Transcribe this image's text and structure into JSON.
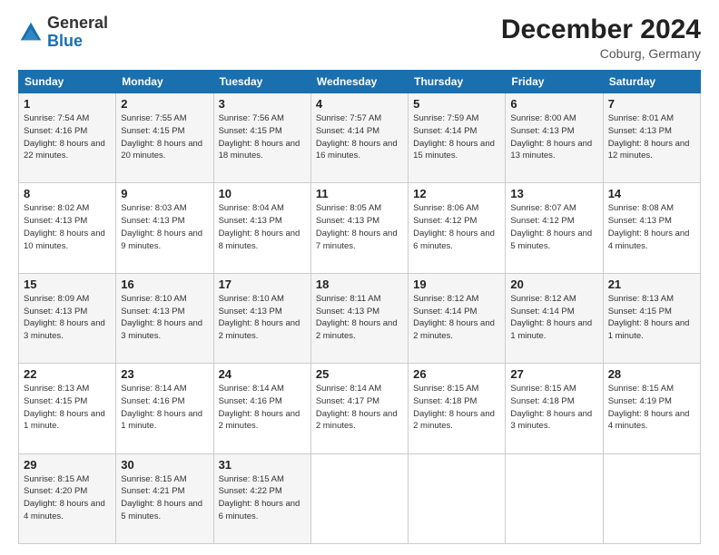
{
  "header": {
    "logo_general": "General",
    "logo_blue": "Blue",
    "month_title": "December 2024",
    "location": "Coburg, Germany"
  },
  "days_of_week": [
    "Sunday",
    "Monday",
    "Tuesday",
    "Wednesday",
    "Thursday",
    "Friday",
    "Saturday"
  ],
  "weeks": [
    [
      {
        "day": 1,
        "sunrise": "7:54 AM",
        "sunset": "4:16 PM",
        "daylight": "8 hours and 22 minutes."
      },
      {
        "day": 2,
        "sunrise": "7:55 AM",
        "sunset": "4:15 PM",
        "daylight": "8 hours and 20 minutes."
      },
      {
        "day": 3,
        "sunrise": "7:56 AM",
        "sunset": "4:15 PM",
        "daylight": "8 hours and 18 minutes."
      },
      {
        "day": 4,
        "sunrise": "7:57 AM",
        "sunset": "4:14 PM",
        "daylight": "8 hours and 16 minutes."
      },
      {
        "day": 5,
        "sunrise": "7:59 AM",
        "sunset": "4:14 PM",
        "daylight": "8 hours and 15 minutes."
      },
      {
        "day": 6,
        "sunrise": "8:00 AM",
        "sunset": "4:13 PM",
        "daylight": "8 hours and 13 minutes."
      },
      {
        "day": 7,
        "sunrise": "8:01 AM",
        "sunset": "4:13 PM",
        "daylight": "8 hours and 12 minutes."
      }
    ],
    [
      {
        "day": 8,
        "sunrise": "8:02 AM",
        "sunset": "4:13 PM",
        "daylight": "8 hours and 10 minutes."
      },
      {
        "day": 9,
        "sunrise": "8:03 AM",
        "sunset": "4:13 PM",
        "daylight": "8 hours and 9 minutes."
      },
      {
        "day": 10,
        "sunrise": "8:04 AM",
        "sunset": "4:13 PM",
        "daylight": "8 hours and 8 minutes."
      },
      {
        "day": 11,
        "sunrise": "8:05 AM",
        "sunset": "4:13 PM",
        "daylight": "8 hours and 7 minutes."
      },
      {
        "day": 12,
        "sunrise": "8:06 AM",
        "sunset": "4:12 PM",
        "daylight": "8 hours and 6 minutes."
      },
      {
        "day": 13,
        "sunrise": "8:07 AM",
        "sunset": "4:12 PM",
        "daylight": "8 hours and 5 minutes."
      },
      {
        "day": 14,
        "sunrise": "8:08 AM",
        "sunset": "4:13 PM",
        "daylight": "8 hours and 4 minutes."
      }
    ],
    [
      {
        "day": 15,
        "sunrise": "8:09 AM",
        "sunset": "4:13 PM",
        "daylight": "8 hours and 3 minutes."
      },
      {
        "day": 16,
        "sunrise": "8:10 AM",
        "sunset": "4:13 PM",
        "daylight": "8 hours and 3 minutes."
      },
      {
        "day": 17,
        "sunrise": "8:10 AM",
        "sunset": "4:13 PM",
        "daylight": "8 hours and 2 minutes."
      },
      {
        "day": 18,
        "sunrise": "8:11 AM",
        "sunset": "4:13 PM",
        "daylight": "8 hours and 2 minutes."
      },
      {
        "day": 19,
        "sunrise": "8:12 AM",
        "sunset": "4:14 PM",
        "daylight": "8 hours and 2 minutes."
      },
      {
        "day": 20,
        "sunrise": "8:12 AM",
        "sunset": "4:14 PM",
        "daylight": "8 hours and 1 minute."
      },
      {
        "day": 21,
        "sunrise": "8:13 AM",
        "sunset": "4:15 PM",
        "daylight": "8 hours and 1 minute."
      }
    ],
    [
      {
        "day": 22,
        "sunrise": "8:13 AM",
        "sunset": "4:15 PM",
        "daylight": "8 hours and 1 minute."
      },
      {
        "day": 23,
        "sunrise": "8:14 AM",
        "sunset": "4:16 PM",
        "daylight": "8 hours and 1 minute."
      },
      {
        "day": 24,
        "sunrise": "8:14 AM",
        "sunset": "4:16 PM",
        "daylight": "8 hours and 2 minutes."
      },
      {
        "day": 25,
        "sunrise": "8:14 AM",
        "sunset": "4:17 PM",
        "daylight": "8 hours and 2 minutes."
      },
      {
        "day": 26,
        "sunrise": "8:15 AM",
        "sunset": "4:18 PM",
        "daylight": "8 hours and 2 minutes."
      },
      {
        "day": 27,
        "sunrise": "8:15 AM",
        "sunset": "4:18 PM",
        "daylight": "8 hours and 3 minutes."
      },
      {
        "day": 28,
        "sunrise": "8:15 AM",
        "sunset": "4:19 PM",
        "daylight": "8 hours and 4 minutes."
      }
    ],
    [
      {
        "day": 29,
        "sunrise": "8:15 AM",
        "sunset": "4:20 PM",
        "daylight": "8 hours and 4 minutes."
      },
      {
        "day": 30,
        "sunrise": "8:15 AM",
        "sunset": "4:21 PM",
        "daylight": "8 hours and 5 minutes."
      },
      {
        "day": 31,
        "sunrise": "8:15 AM",
        "sunset": "4:22 PM",
        "daylight": "8 hours and 6 minutes."
      },
      null,
      null,
      null,
      null
    ]
  ]
}
